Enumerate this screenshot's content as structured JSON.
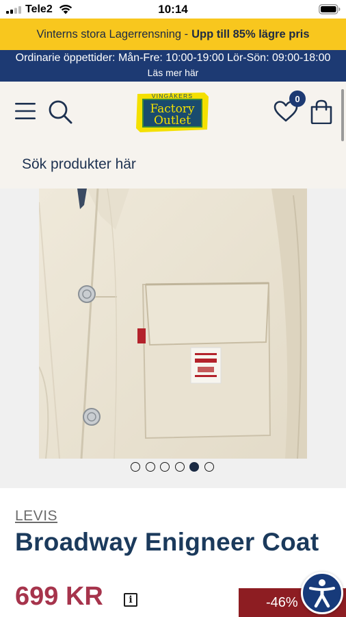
{
  "status_bar": {
    "carrier": "Tele2",
    "time": "10:14"
  },
  "promo": {
    "text": "Vinterns stora Lagerrensning -",
    "highlight": "Upp till 85% lägre pris"
  },
  "hours": {
    "text": "Ordinarie öppettider: Mån-Fre: 10:00-19:00 Lör-Sön: 09:00-18:00",
    "link": "Läs mer här"
  },
  "header": {
    "logo": {
      "top": "VINGÅKERS",
      "line1": "Factory",
      "line2": "Outlet"
    },
    "wishlist_count": "0",
    "icons": [
      "menu-icon",
      "search-icon",
      "heart-icon",
      "bag-icon"
    ]
  },
  "search": {
    "placeholder": "Sök produkter här"
  },
  "gallery": {
    "total_images": 6,
    "active_index": 4
  },
  "product": {
    "brand": "LEVIS",
    "title": "Broadway Enigneer Coat",
    "price": "699 KR",
    "info": "i",
    "discount": "-46%"
  },
  "colors": {
    "promo_bg": "#f8c71e",
    "hours_bg": "#1d3a73",
    "header_bg": "#f6f3ee",
    "title": "#1b3a5c",
    "price": "#a6344c",
    "discount_bg": "#8d1d22"
  }
}
